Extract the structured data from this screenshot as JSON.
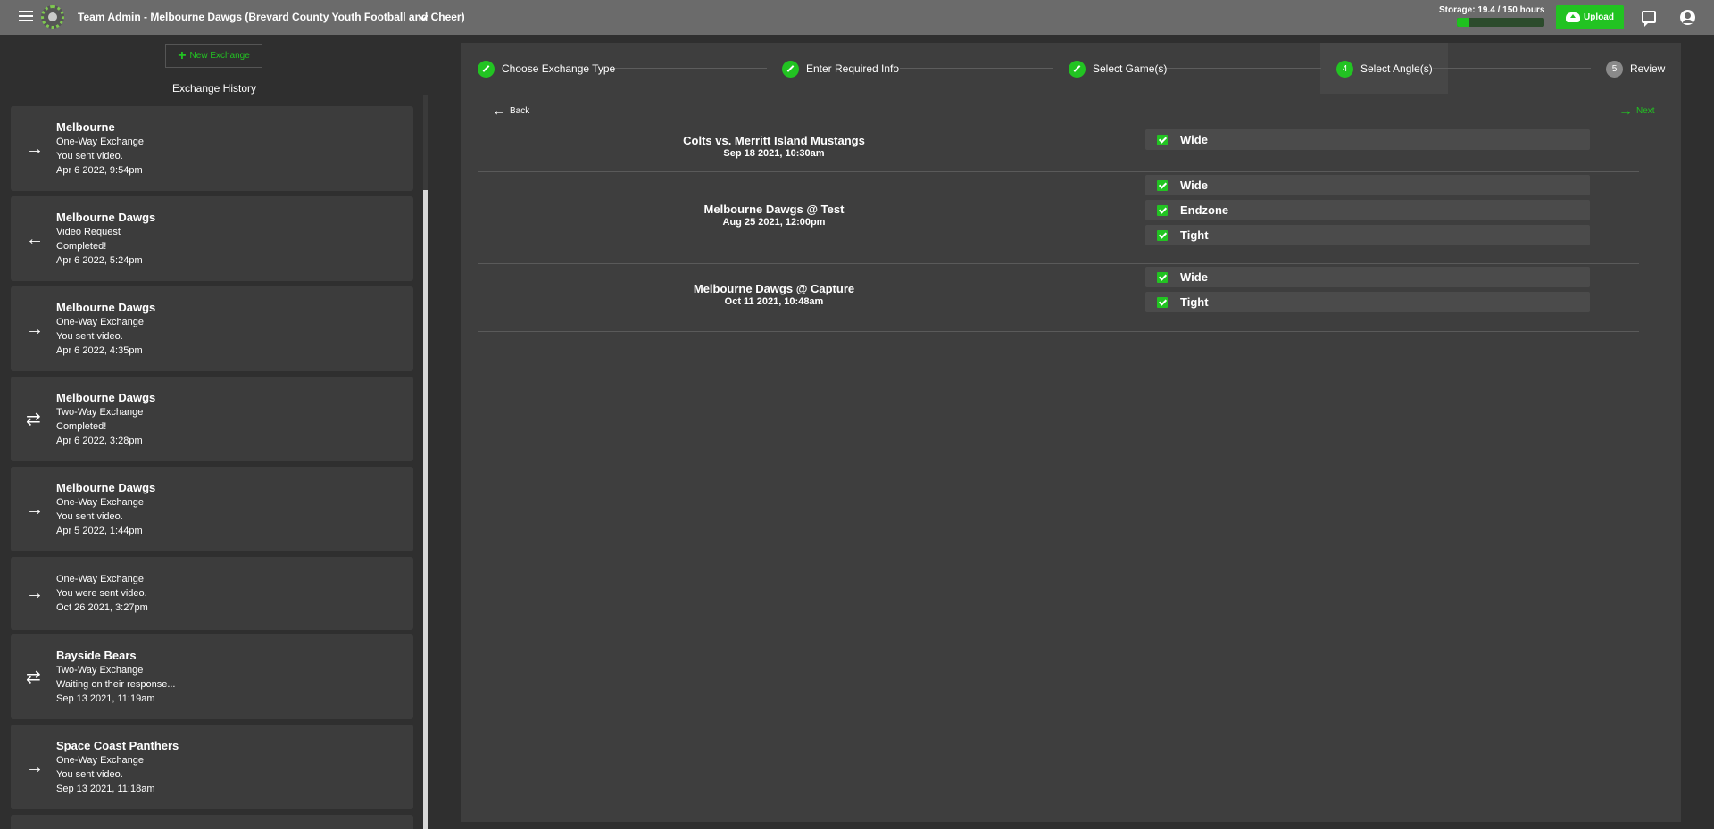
{
  "header": {
    "team_title": "Team Admin - Melbourne Dawgs (Brevard County Youth Football and Cheer)",
    "storage_label": "Storage: 19.4 / 150 hours",
    "storage_fraction": 0.13,
    "upload_label": "Upload",
    "colors": {
      "accent": "#22c322",
      "topbar": "#6b6b6b"
    }
  },
  "sidebar": {
    "new_exchange_label": "New Exchange",
    "history_title": "Exchange History",
    "items": [
      {
        "icon": "arrow-right-icon",
        "name": "Melbourne",
        "type": "One-Way Exchange",
        "status": "You sent video.",
        "date": "Apr 6 2022, 9:54pm"
      },
      {
        "icon": "arrow-left-icon",
        "name": "Melbourne Dawgs",
        "type": "Video Request",
        "status": "Completed!",
        "date": "Apr 6 2022, 5:24pm"
      },
      {
        "icon": "arrow-right-icon",
        "name": "Melbourne Dawgs",
        "type": "One-Way Exchange",
        "status": "You sent video.",
        "date": "Apr 6 2022, 4:35pm"
      },
      {
        "icon": "swap-icon",
        "name": "Melbourne Dawgs",
        "type": "Two-Way Exchange",
        "status": "Completed!",
        "date": "Apr 6 2022, 3:28pm"
      },
      {
        "icon": "arrow-right-icon",
        "name": "Melbourne Dawgs",
        "type": "One-Way Exchange",
        "status": "You sent video.",
        "date": "Apr 5 2022, 1:44pm"
      },
      {
        "icon": "arrow-right-icon",
        "name": "",
        "type": "One-Way Exchange",
        "status": "You were sent video.",
        "date": "Oct 26 2021, 3:27pm"
      },
      {
        "icon": "swap-icon",
        "name": "Bayside Bears",
        "type": "Two-Way Exchange",
        "status": "Waiting on their response...",
        "date": "Sep 13 2021, 11:19am"
      },
      {
        "icon": "arrow-right-icon",
        "name": "Space Coast Panthers",
        "type": "One-Way Exchange",
        "status": "You sent video.",
        "date": "Sep 13 2021, 11:18am"
      }
    ]
  },
  "stepper": {
    "steps": [
      {
        "label": "Choose Exchange Type",
        "state": "done",
        "number": "1"
      },
      {
        "label": "Enter Required Info",
        "state": "done",
        "number": "2"
      },
      {
        "label": "Select Game(s)",
        "state": "done",
        "number": "3"
      },
      {
        "label": "Select Angle(s)",
        "state": "active",
        "number": "4"
      },
      {
        "label": "Review",
        "state": "pending",
        "number": "5"
      }
    ]
  },
  "nav": {
    "back_label": "Back",
    "next_label": "Next"
  },
  "games": [
    {
      "name": "Colts vs. Merritt Island Mustangs",
      "date": "Sep 18 2021, 10:30am",
      "angles": [
        {
          "label": "Wide",
          "checked": true
        }
      ]
    },
    {
      "name": "Melbourne Dawgs @ Test",
      "date": "Aug 25 2021, 12:00pm",
      "angles": [
        {
          "label": "Wide",
          "checked": true
        },
        {
          "label": "Endzone",
          "checked": true
        },
        {
          "label": "Tight",
          "checked": true
        }
      ]
    },
    {
      "name": "Melbourne Dawgs @ Capture",
      "date": "Oct 11 2021, 10:48am",
      "angles": [
        {
          "label": "Wide",
          "checked": true
        },
        {
          "label": "Tight",
          "checked": true
        }
      ]
    }
  ]
}
